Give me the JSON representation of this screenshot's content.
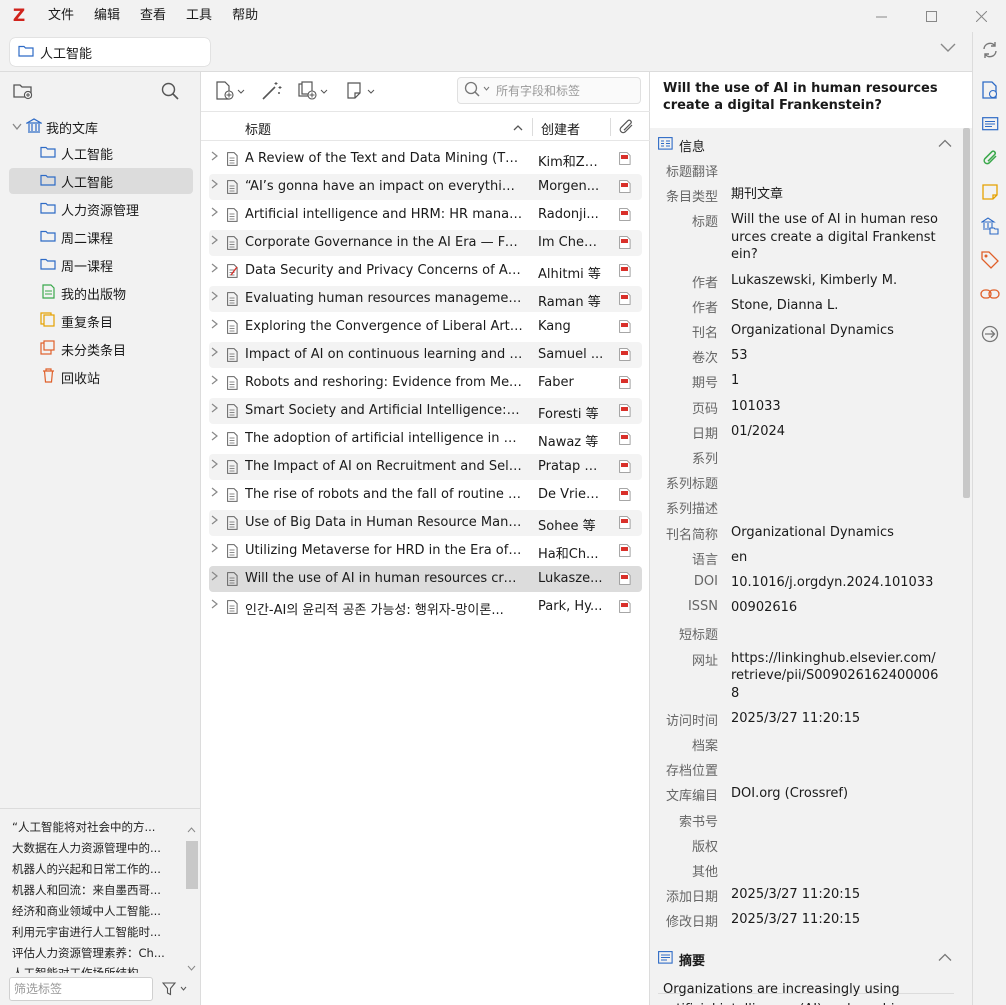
{
  "app": {
    "logo": "Z"
  },
  "menu": [
    "文件",
    "编辑",
    "查看",
    "工具",
    "帮助"
  ],
  "tab": {
    "label": "人工智能"
  },
  "collections": {
    "root": "我的文库",
    "items": [
      {
        "label": "人工智能",
        "icon": "folder-icon"
      },
      {
        "label": "人工智能",
        "icon": "folder-icon",
        "selected": true
      },
      {
        "label": "人力资源管理",
        "icon": "folder-icon"
      },
      {
        "label": "周二课程",
        "icon": "folder-icon"
      },
      {
        "label": "周一课程",
        "icon": "folder-icon"
      },
      {
        "label": "我的出版物",
        "icon": "publications-icon"
      },
      {
        "label": "重复条目",
        "icon": "duplicates-icon"
      },
      {
        "label": "未分类条目",
        "icon": "unfiled-icon"
      },
      {
        "label": "回收站",
        "icon": "trash-icon"
      }
    ]
  },
  "tags": {
    "lines": [
      "“人工智能将对社会中的方...",
      "大数据在人力资源管理中的...",
      "机器人的兴起和日常工作的...",
      "机器人和回流：来自墨西哥...",
      "经济和商业领域中人工智能...",
      "利用元宇宙进行人工智能时...",
      "评估人力资源管理素养：Ch...",
      "人工智能对工作场所结构..."
    ],
    "filter_placeholder": "筛选标签"
  },
  "items": {
    "search_placeholder": "所有字段和标签",
    "columns": {
      "title": "标题",
      "creator": "创建者"
    },
    "rows": [
      {
        "title": "A Review of the Text and Data Mining (TDM)...",
        "creator": "Kim和Zh..."
      },
      {
        "title": "“AI’s gonna have an impact on everything in...",
        "creator": "Morgen..."
      },
      {
        "title": "Artificial intelligence and HRM: HR manag...",
        "creator": "Radonji..."
      },
      {
        "title": "Corporate Governance in the AI Era — Foc...",
        "creator": "Im Cheo..."
      },
      {
        "title": "Data Security and Privacy Concerns of Ai-...",
        "creator": "Alhitmi 等"
      },
      {
        "title": "Evaluating human resources management ...",
        "creator": "Raman 等"
      },
      {
        "title": "Exploring the Convergence of Liberal Arts ...",
        "creator": "Kang"
      },
      {
        "title": "Impact of AI on continuous learning and s...",
        "creator": "Samuel ..."
      },
      {
        "title": "Robots and reshoring: Evidence from Mexi...",
        "creator": "Faber"
      },
      {
        "title": "Smart Society and Artificial Intelligence: Bi...",
        "creator": "Foresti 等"
      },
      {
        "title": "The adoption of artificial intelligence in hu...",
        "creator": "Nawaz 等"
      },
      {
        "title": "The Impact of AI on Recruitment and Selec...",
        "creator": "Pratap S..."
      },
      {
        "title": "The rise of robots and the fall of routine jo...",
        "creator": "De Vries..."
      },
      {
        "title": "Use of Big Data in Human Resource Mana...",
        "creator": "Sohee 等"
      },
      {
        "title": "Utilizing Metaverse for HRD in the Era of A...",
        "creator": "Ha和Ch..."
      },
      {
        "title": "Will the use of AI in human resources creat...",
        "creator": "Lukasze..."
      },
      {
        "title": "인간-AI의 윤리적 공존 가능성: 행위자-망이론...",
        "creator": "Park, Hy..."
      }
    ],
    "selected_index": 15
  },
  "detail": {
    "title": "Will the use of AI in human resources create a digital Frankenstein?",
    "info_header": "信息",
    "fields": [
      {
        "label": "标题翻译",
        "value": ""
      },
      {
        "label": "条目类型",
        "value": "期刊文章"
      },
      {
        "label": "标题",
        "value": "Will the use of AI in human resources create a digital Frankenstein?"
      },
      {
        "label": "作者",
        "value": "Lukaszewski, Kimberly M."
      },
      {
        "label": "作者",
        "value": "Stone, Dianna L."
      },
      {
        "label": "刊名",
        "value": "Organizational Dynamics"
      },
      {
        "label": "卷次",
        "value": "53"
      },
      {
        "label": "期号",
        "value": "1"
      },
      {
        "label": "页码",
        "value": "101033"
      },
      {
        "label": "日期",
        "value": "01/2024"
      },
      {
        "label": "系列",
        "value": ""
      },
      {
        "label": "系列标题",
        "value": ""
      },
      {
        "label": "系列描述",
        "value": ""
      },
      {
        "label": "刊名简称",
        "value": "Organizational Dynamics"
      },
      {
        "label": "语言",
        "value": "en"
      },
      {
        "label": "DOI",
        "value": "10.1016/j.orgdyn.2024.101033"
      },
      {
        "label": "ISSN",
        "value": "00902616"
      },
      {
        "label": "短标题",
        "value": ""
      },
      {
        "label": "网址",
        "value": "https://linkinghub.elsevier.com/retrieve/pii/S0090261624000068"
      },
      {
        "label": "访问时间",
        "value": "2025/3/27 11:20:15"
      },
      {
        "label": "档案",
        "value": ""
      },
      {
        "label": "存档位置",
        "value": ""
      },
      {
        "label": "文库编目",
        "value": "DOI.org (Crossref)"
      },
      {
        "label": "索书号",
        "value": ""
      },
      {
        "label": "版权",
        "value": ""
      },
      {
        "label": "其他",
        "value": ""
      },
      {
        "label": "添加日期",
        "value": "2025/3/27 11:20:15"
      },
      {
        "label": "修改日期",
        "value": "2025/3/27 11:20:15"
      }
    ],
    "abstract_header": "摘要",
    "abstract": "Organizations are increasingly using artificial intelligence (AI) and machine learning (ML) to"
  },
  "colors": {
    "accent": "#2e6bc6",
    "logo": "#d0231c",
    "pdf": "#d9302a"
  }
}
